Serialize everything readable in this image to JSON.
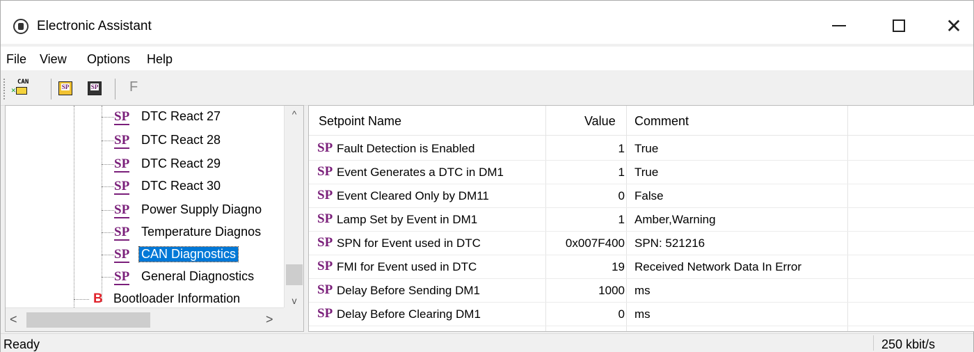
{
  "window": {
    "title": "Electronic Assistant",
    "close_glyph": "✕"
  },
  "menu": [
    "File",
    "View",
    "Options",
    "Help"
  ],
  "toolbar": {
    "can_label": "CAN",
    "sp_label": "SP",
    "f_label": "F"
  },
  "tree": {
    "items": [
      {
        "label": "DTC React 27"
      },
      {
        "label": "DTC React 28"
      },
      {
        "label": "DTC React 29"
      },
      {
        "label": "DTC React 30"
      },
      {
        "label": "Power Supply Diagno"
      },
      {
        "label": "Temperature Diagnos"
      },
      {
        "label": "CAN Diagnostics",
        "selected": true
      },
      {
        "label": "General Diagnostics"
      }
    ],
    "bootloader": {
      "icon": "B",
      "label": "Bootloader Information"
    },
    "sp_icon": "SP",
    "scroll_up": "^",
    "scroll_down": "v",
    "scroll_left": "<",
    "scroll_right": ">"
  },
  "grid": {
    "headers": {
      "name": "Setpoint Name",
      "value": "Value",
      "comment": "Comment"
    },
    "sp_icon": "SP",
    "rows": [
      {
        "name": "Fault Detection is Enabled",
        "value": "1",
        "comment": "True"
      },
      {
        "name": "Event Generates a DTC in DM1",
        "value": "1",
        "comment": "True"
      },
      {
        "name": "Event Cleared Only by DM11",
        "value": "0",
        "comment": "False"
      },
      {
        "name": "Lamp Set by Event in DM1",
        "value": "1",
        "comment": "Amber,Warning"
      },
      {
        "name": "SPN for Event used in DTC",
        "value": "0x007F400",
        "comment": "SPN: 521216"
      },
      {
        "name": "FMI for Event used in DTC",
        "value": "19",
        "comment": "Received Network Data In Error"
      },
      {
        "name": "Delay Before Sending DM1",
        "value": "1000",
        "comment": "ms"
      },
      {
        "name": "Delay Before Clearing DM1",
        "value": "0",
        "comment": "ms"
      }
    ]
  },
  "status": {
    "text": "Ready",
    "baud": "250 kbit/s"
  },
  "colors": {
    "sp_purple": "#7a1f7a",
    "selection": "#0078d7",
    "bootloader_red": "#e0242c"
  }
}
